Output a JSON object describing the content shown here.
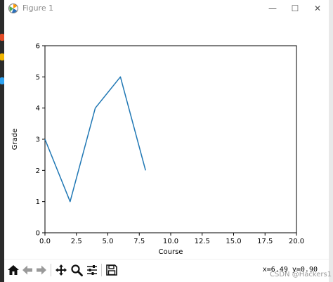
{
  "window": {
    "title": "Figure 1",
    "minimize_glyph": "—",
    "maximize_glyph": "☐",
    "close_glyph": "✕"
  },
  "chart_data": {
    "type": "line",
    "x": [
      0,
      2,
      4,
      6,
      8
    ],
    "series": [
      {
        "values": [
          3,
          1,
          4,
          5,
          2
        ],
        "color": "#1f77b4"
      }
    ],
    "xlabel": "Course",
    "ylabel": "Grade",
    "xlim": [
      0,
      20
    ],
    "ylim": [
      0,
      6
    ],
    "xticks": [
      "0.0",
      "2.5",
      "5.0",
      "7.5",
      "10.0",
      "12.5",
      "15.0",
      "17.5",
      "20.0"
    ],
    "yticks": [
      "0",
      "1",
      "2",
      "3",
      "4",
      "5",
      "6"
    ],
    "grid": false
  },
  "toolbar": {
    "coords": "x=6.49 y=0.90",
    "icons": [
      "home-icon",
      "back-arrow-icon",
      "forward-arrow-icon",
      "pan-icon",
      "zoom-icon",
      "configure-subplots-icon",
      "save-icon"
    ]
  },
  "watermark": "CSDN @Hackers1",
  "colors": {
    "line": "#1f77b4",
    "axes": "#000000",
    "strip_dark": "#2b2b2b"
  }
}
